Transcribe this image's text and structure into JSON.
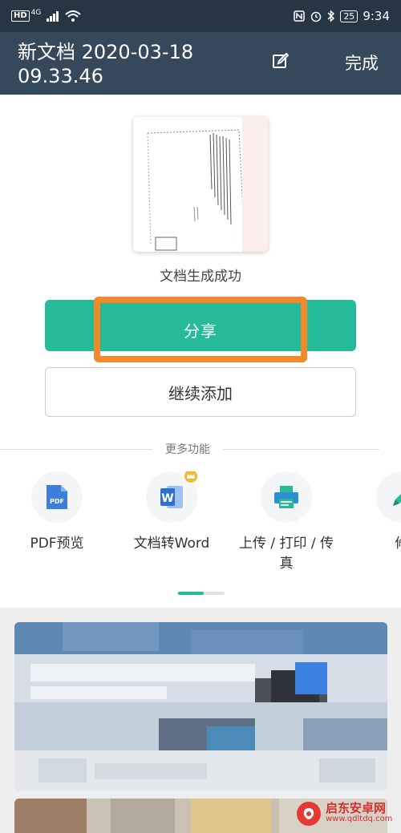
{
  "status_bar": {
    "hd_badge": "HD",
    "network": "4G",
    "battery": "25",
    "time": "9:34"
  },
  "header": {
    "title": "新文档 2020-03-18 09.33.46",
    "done_label": "完成",
    "edit_icon": "edit-icon"
  },
  "document": {
    "success_text": "文档生成成功"
  },
  "actions": {
    "share_label": "分享",
    "continue_label": "继续添加",
    "highlight_color": "#f08a2c",
    "accent_color": "#25bb98"
  },
  "more": {
    "label": "更多功能",
    "features": [
      {
        "label": "PDF预览",
        "icon": "pdf-icon"
      },
      {
        "label": "文档转Word",
        "icon": "word-icon"
      },
      {
        "label": "上传 / 打印 / 传真",
        "icon": "printer-icon"
      },
      {
        "label": "修",
        "icon": "pen-icon"
      }
    ]
  },
  "watermark": {
    "name": "启东安卓网",
    "url": "www.qdltdq.com"
  }
}
